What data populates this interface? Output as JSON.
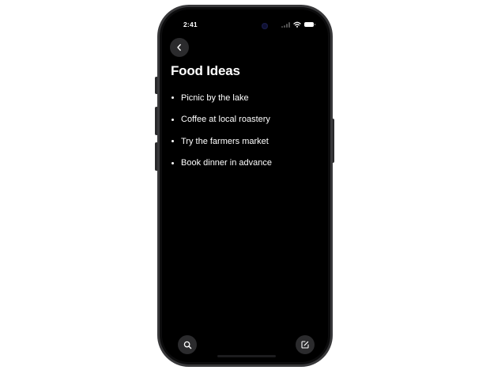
{
  "status_bar": {
    "time": "2:41",
    "icons": [
      "signal-icon",
      "wifi-icon",
      "battery-icon"
    ]
  },
  "navigation": {
    "back_icon": "chevron-left-icon"
  },
  "note": {
    "title": "Food Ideas",
    "items": [
      "Picnic by the lake",
      "Coffee at local roastery",
      "Try the farmers market",
      "Book dinner in advance"
    ]
  },
  "toolbar": {
    "search_icon": "search-icon",
    "compose_icon": "compose-icon"
  },
  "colors": {
    "screen_background": "#000000",
    "text": "#ffffff",
    "button_background": "#2b2b2d",
    "device_frame": "#38383a"
  }
}
